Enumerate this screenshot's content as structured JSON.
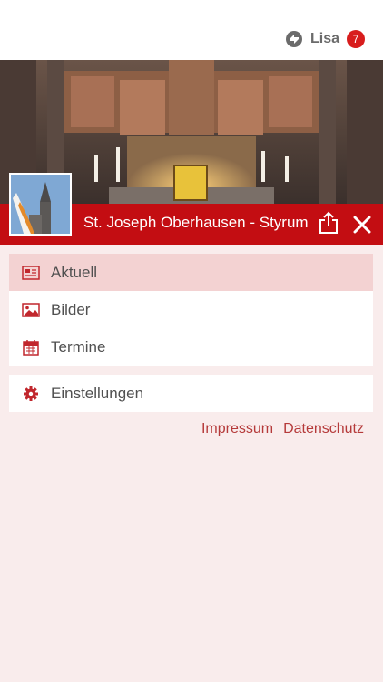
{
  "header": {
    "user_name": "Lisa",
    "notification_count": "7",
    "user_icon": "sync-icon"
  },
  "page": {
    "title": "St. Joseph Oberhausen - Styrum",
    "share_icon": "share-icon",
    "close_icon": "close-icon"
  },
  "menu": {
    "items": [
      {
        "label": "Aktuell",
        "icon": "newspaper-icon",
        "active": true
      },
      {
        "label": "Bilder",
        "icon": "image-icon",
        "active": false
      },
      {
        "label": "Termine",
        "icon": "calendar-icon",
        "active": false
      }
    ],
    "settings": {
      "label": "Einstellungen",
      "icon": "gear-icon"
    }
  },
  "footer": {
    "impressum": "Impressum",
    "datenschutz": "Datenschutz"
  },
  "colors": {
    "brand_red": "#c30d12",
    "background": "#f9ecec",
    "active_item": "#f3d2d2",
    "link": "#b53a3a"
  }
}
